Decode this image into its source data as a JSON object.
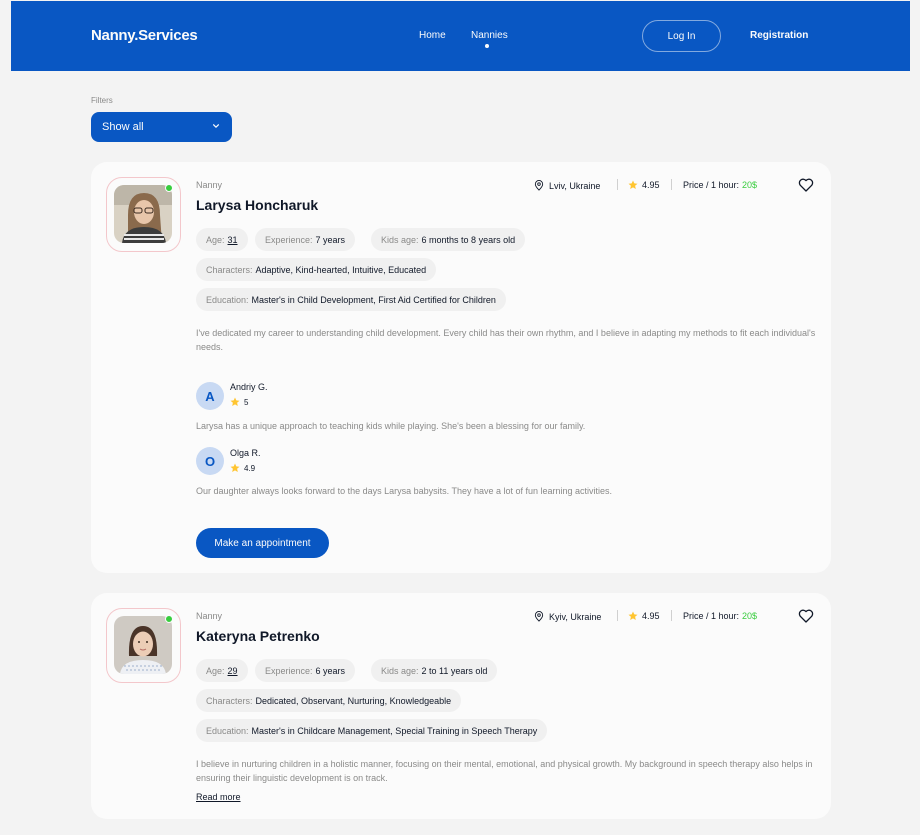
{
  "header": {
    "logo": "Nanny.Services",
    "nav": {
      "home": "Home",
      "nannies": "Nannies"
    },
    "login": "Log In",
    "register": "Registration"
  },
  "filters": {
    "label": "Filters",
    "selected": "Show all"
  },
  "colors": {
    "brand": "#0957c3",
    "online": "#38cd3e",
    "price": "#38cd3e",
    "star": "#ffc531"
  },
  "nannies": [
    {
      "role": "Nanny",
      "name": "Larysa Honcharuk",
      "location": "Lviv, Ukraine",
      "rating": "4.95",
      "price_label": "Price / 1 hour:",
      "price": "20$",
      "age_label": "Age:",
      "age": "31",
      "experience_label": "Experience:",
      "experience": "7 years",
      "kids_age_label": "Kids age:",
      "kids_age": "6 months to 8 years old",
      "characters_label": "Characters:",
      "characters": "Adaptive, Kind-hearted, Intuitive, Educated",
      "education_label": "Education:",
      "education": "Master's in Child Development, First Aid Certified for Children",
      "about": "I've dedicated my career to understanding child development. Every child has their own rhythm, and I believe in adapting my methods to fit each individual's needs.",
      "reviews": [
        {
          "initial": "A",
          "name": "Andriy G.",
          "rating": "5",
          "text": "Larysa has a unique approach to teaching kids while playing. She's been a blessing for our family."
        },
        {
          "initial": "O",
          "name": "Olga R.",
          "rating": "4.9",
          "text": "Our daughter always looks forward to the days Larysa babysits. They have a lot of fun learning activities."
        }
      ],
      "cta": "Make an appointment"
    },
    {
      "role": "Nanny",
      "name": "Kateryna Petrenko",
      "location": "Kyiv, Ukraine",
      "rating": "4.95",
      "price_label": "Price / 1 hour:",
      "price": "20$",
      "age_label": "Age:",
      "age": "29",
      "experience_label": "Experience:",
      "experience": "6 years",
      "kids_age_label": "Kids age:",
      "kids_age": "2 to 11 years old",
      "characters_label": "Characters:",
      "characters": "Dedicated, Observant, Nurturing, Knowledgeable",
      "education_label": "Education:",
      "education": "Master's in Childcare Management, Special Training in Speech Therapy",
      "about": "I believe in nurturing children in a holistic manner, focusing on their mental, emotional, and physical growth. My background in speech therapy also helps in ensuring their linguistic development is on track.",
      "read_more": "Read more"
    }
  ]
}
